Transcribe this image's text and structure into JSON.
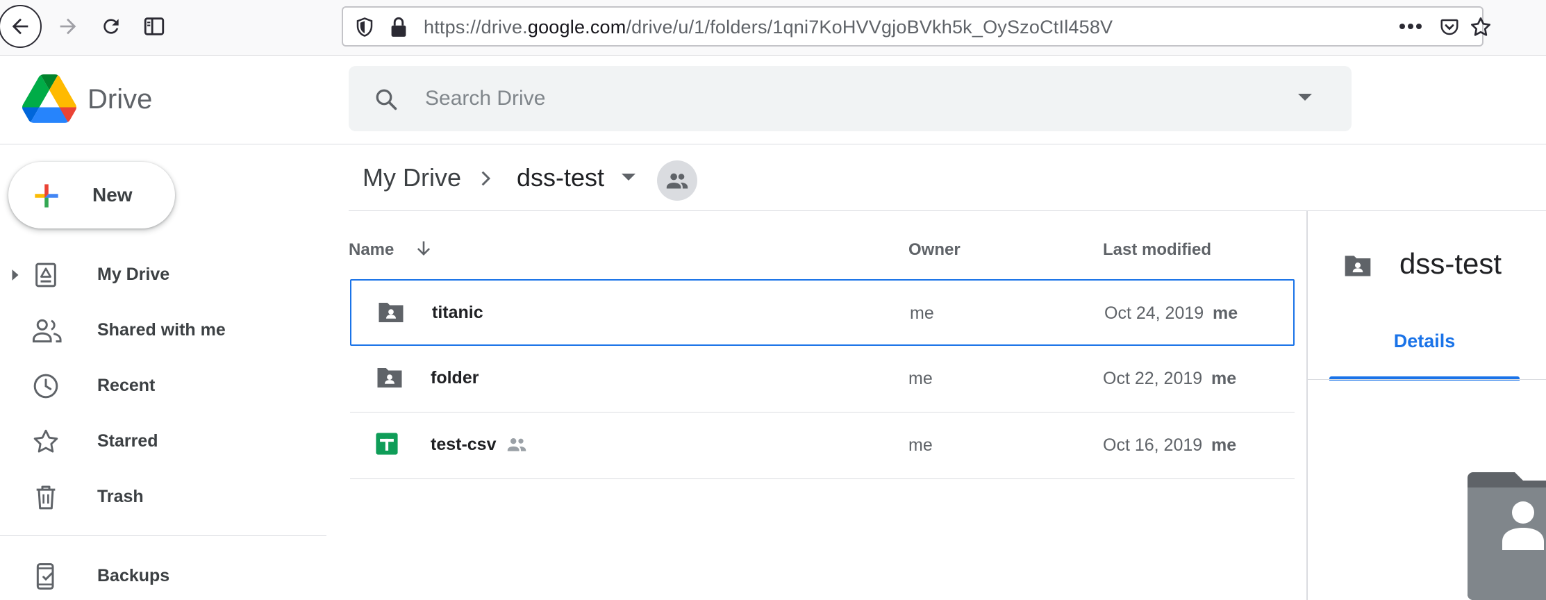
{
  "browser": {
    "url_prefix": "https://drive.",
    "url_domain": "google.com",
    "url_path": "/drive/u/1/folders/1qni7KoHVVgjoBVkh5k_OySzoCtIl458V"
  },
  "header": {
    "app_name": "Drive",
    "search_placeholder": "Search Drive"
  },
  "sidebar": {
    "new_label": "New",
    "items": [
      {
        "label": "My Drive",
        "icon": "my-drive-icon"
      },
      {
        "label": "Shared with me",
        "icon": "people-icon"
      },
      {
        "label": "Recent",
        "icon": "clock-icon"
      },
      {
        "label": "Starred",
        "icon": "star-icon"
      },
      {
        "label": "Trash",
        "icon": "trash-icon"
      },
      {
        "label": "Backups",
        "icon": "phone-backup-icon"
      }
    ]
  },
  "breadcrumb": {
    "root": "My Drive",
    "current": "dss-test"
  },
  "list": {
    "columns": {
      "name": "Name",
      "owner": "Owner",
      "modified": "Last modified"
    },
    "rows": [
      {
        "name": "titanic",
        "type": "shared-folder",
        "owner": "me",
        "date": "Oct 24, 2019",
        "by": "me",
        "selected": true
      },
      {
        "name": "folder",
        "type": "shared-folder",
        "owner": "me",
        "date": "Oct 22, 2019",
        "by": "me",
        "selected": false
      },
      {
        "name": "test-csv",
        "type": "google-sheet",
        "shared": true,
        "owner": "me",
        "date": "Oct 16, 2019",
        "by": "me",
        "selected": false
      }
    ]
  },
  "details": {
    "title": "dss-test",
    "tab": "Details"
  },
  "colors": {
    "accent": "#1a73e8",
    "sheets_green": "#0f9d58",
    "icon_gray": "#5f6368"
  }
}
